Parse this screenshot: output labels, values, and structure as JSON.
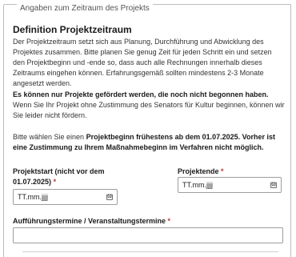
{
  "fieldset": {
    "legend": "Angaben zum Zeitraum des Projekts"
  },
  "section": {
    "title": "Definition Projektzeitraum",
    "intro": "Der Projektzeitraum setzt sich aus Planung, Durchführung und Abwicklung des Projektes zusammen. Bitte planen Sie genug Zeit für jeden Schritt ein und setzen den Projektbeginn und -ende so, dass auch alle Rechnungen innerhalb dieses Zeitraums eingehen können. Erfahrungsgemäß sollten mindestens 2-3 Monate angesetzt werden.",
    "warning_bold": "Es können nur Projekte gefördert werden, die noch nicht begonnen haben.",
    "warning_rest": " Wenn Sie Ihr Projekt ohne Zustimmung des Senators für Kultur beginnen, können wir Sie leider nicht fördern.",
    "start_note_prefix": "Bitte wählen Sie einen ",
    "start_note_bold": "Projektbeginn frühestens ab dem 01.07.2025. Vorher ist eine Zustimmung zu Ihrem Maßnahmebeginn im Verfahren nicht möglich."
  },
  "fields": {
    "start": {
      "label_line1": "Projektstart (nicht vor dem",
      "label_line2": "01.07.2025)",
      "required_mark": "*",
      "value": "TT.mm.jjjj"
    },
    "end": {
      "label": "Projektende",
      "required_mark": "*",
      "value": "TT.mm.jjjj"
    },
    "events": {
      "label": "Aufführungstermine / Veranstaltungstermine",
      "required_mark": "*",
      "value": ""
    }
  },
  "icons": {
    "start_calendar": "calendar-icon",
    "end_calendar": "calendar-icon"
  }
}
